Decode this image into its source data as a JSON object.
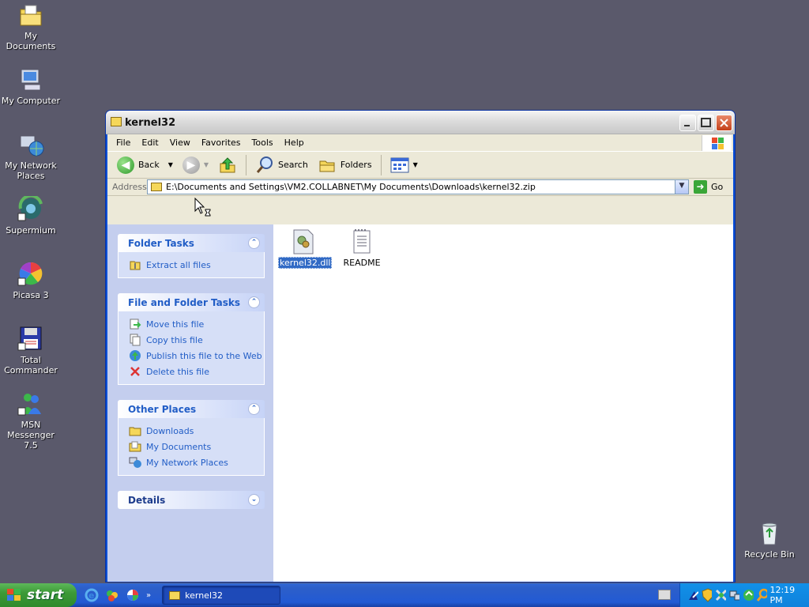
{
  "desktop": {
    "icons": [
      {
        "label": "My Documents"
      },
      {
        "label": "My Computer"
      },
      {
        "label": "My Network Places"
      },
      {
        "label": "Supermium"
      },
      {
        "label": "Picasa 3"
      },
      {
        "label": "Total Commander"
      },
      {
        "label": "MSN Messenger 7.5"
      }
    ],
    "recycle_bin": "Recycle Bin"
  },
  "window": {
    "title": "kernel32",
    "menu": [
      "File",
      "Edit",
      "View",
      "Favorites",
      "Tools",
      "Help"
    ],
    "toolbar": {
      "back": "Back",
      "search": "Search",
      "folders": "Folders"
    },
    "address": {
      "label": "Address",
      "value": "E:\\Documents and Settings\\VM2.COLLABNET\\My Documents\\Downloads\\kernel32.zip",
      "go": "Go"
    },
    "panels": {
      "folder_tasks": {
        "title": "Folder Tasks",
        "items": [
          "Extract all files"
        ]
      },
      "file_folder_tasks": {
        "title": "File and Folder Tasks",
        "items": [
          "Move this file",
          "Copy this file",
          "Publish this file to the Web",
          "Delete this file"
        ]
      },
      "other_places": {
        "title": "Other Places",
        "items": [
          "Downloads",
          "My Documents",
          "My Network Places"
        ]
      },
      "details": {
        "title": "Details"
      }
    },
    "files": [
      {
        "name": "kernel32.dll",
        "selected": true
      },
      {
        "name": "README",
        "selected": false
      }
    ]
  },
  "taskbar": {
    "start": "start",
    "task": "kernel32",
    "clock": "12:19 PM"
  },
  "colors": {
    "desktop": "#5a596b",
    "link": "#215dc6",
    "taskbar": "#225ad4",
    "start_green": "#3c9a37"
  }
}
